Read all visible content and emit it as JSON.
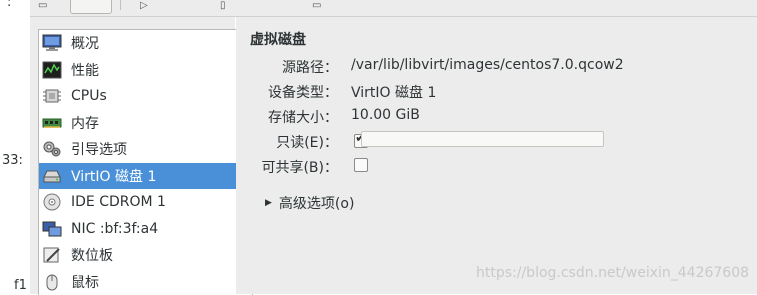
{
  "left_fragments": [
    ":",
    "33:",
    "f1"
  ],
  "sidebar": {
    "items": [
      {
        "label": "概况",
        "icon": "monitor-icon"
      },
      {
        "label": "性能",
        "icon": "performance-chart-icon"
      },
      {
        "label": "CPUs",
        "icon": "cpu-chip-icon"
      },
      {
        "label": "内存",
        "icon": "memory-module-icon"
      },
      {
        "label": "引导选项",
        "icon": "gears-icon"
      },
      {
        "label": "VirtIO 磁盘 1",
        "icon": "hard-disk-icon",
        "selected": true
      },
      {
        "label": "IDE CDROM 1",
        "icon": "cdrom-icon"
      },
      {
        "label": "NIC :bf:3f:a4",
        "icon": "network-card-icon"
      },
      {
        "label": "数位板",
        "icon": "tablet-pen-icon"
      },
      {
        "label": "鼠标",
        "icon": "mouse-icon"
      }
    ]
  },
  "details": {
    "title": "虚拟磁盘",
    "source_path_label": "源路径：",
    "source_path_value": "/var/lib/libvirt/images/centos7.0.qcow2",
    "device_type_label": "设备类型：",
    "device_type_value": "VirtIO 磁盘 1",
    "storage_size_label": "存储大小：",
    "storage_size_value": "10.00 GiB",
    "readonly_label": "只读(E)：",
    "readonly_checked": true,
    "shareable_label": "可共享(B)：",
    "shareable_checked": false,
    "advanced_label": "高级选项(o)"
  },
  "watermark": "https://blog.csdn.net/weixin_44267608",
  "colors": {
    "selection": "#4a90d9",
    "panel_bg": "#ececec"
  }
}
